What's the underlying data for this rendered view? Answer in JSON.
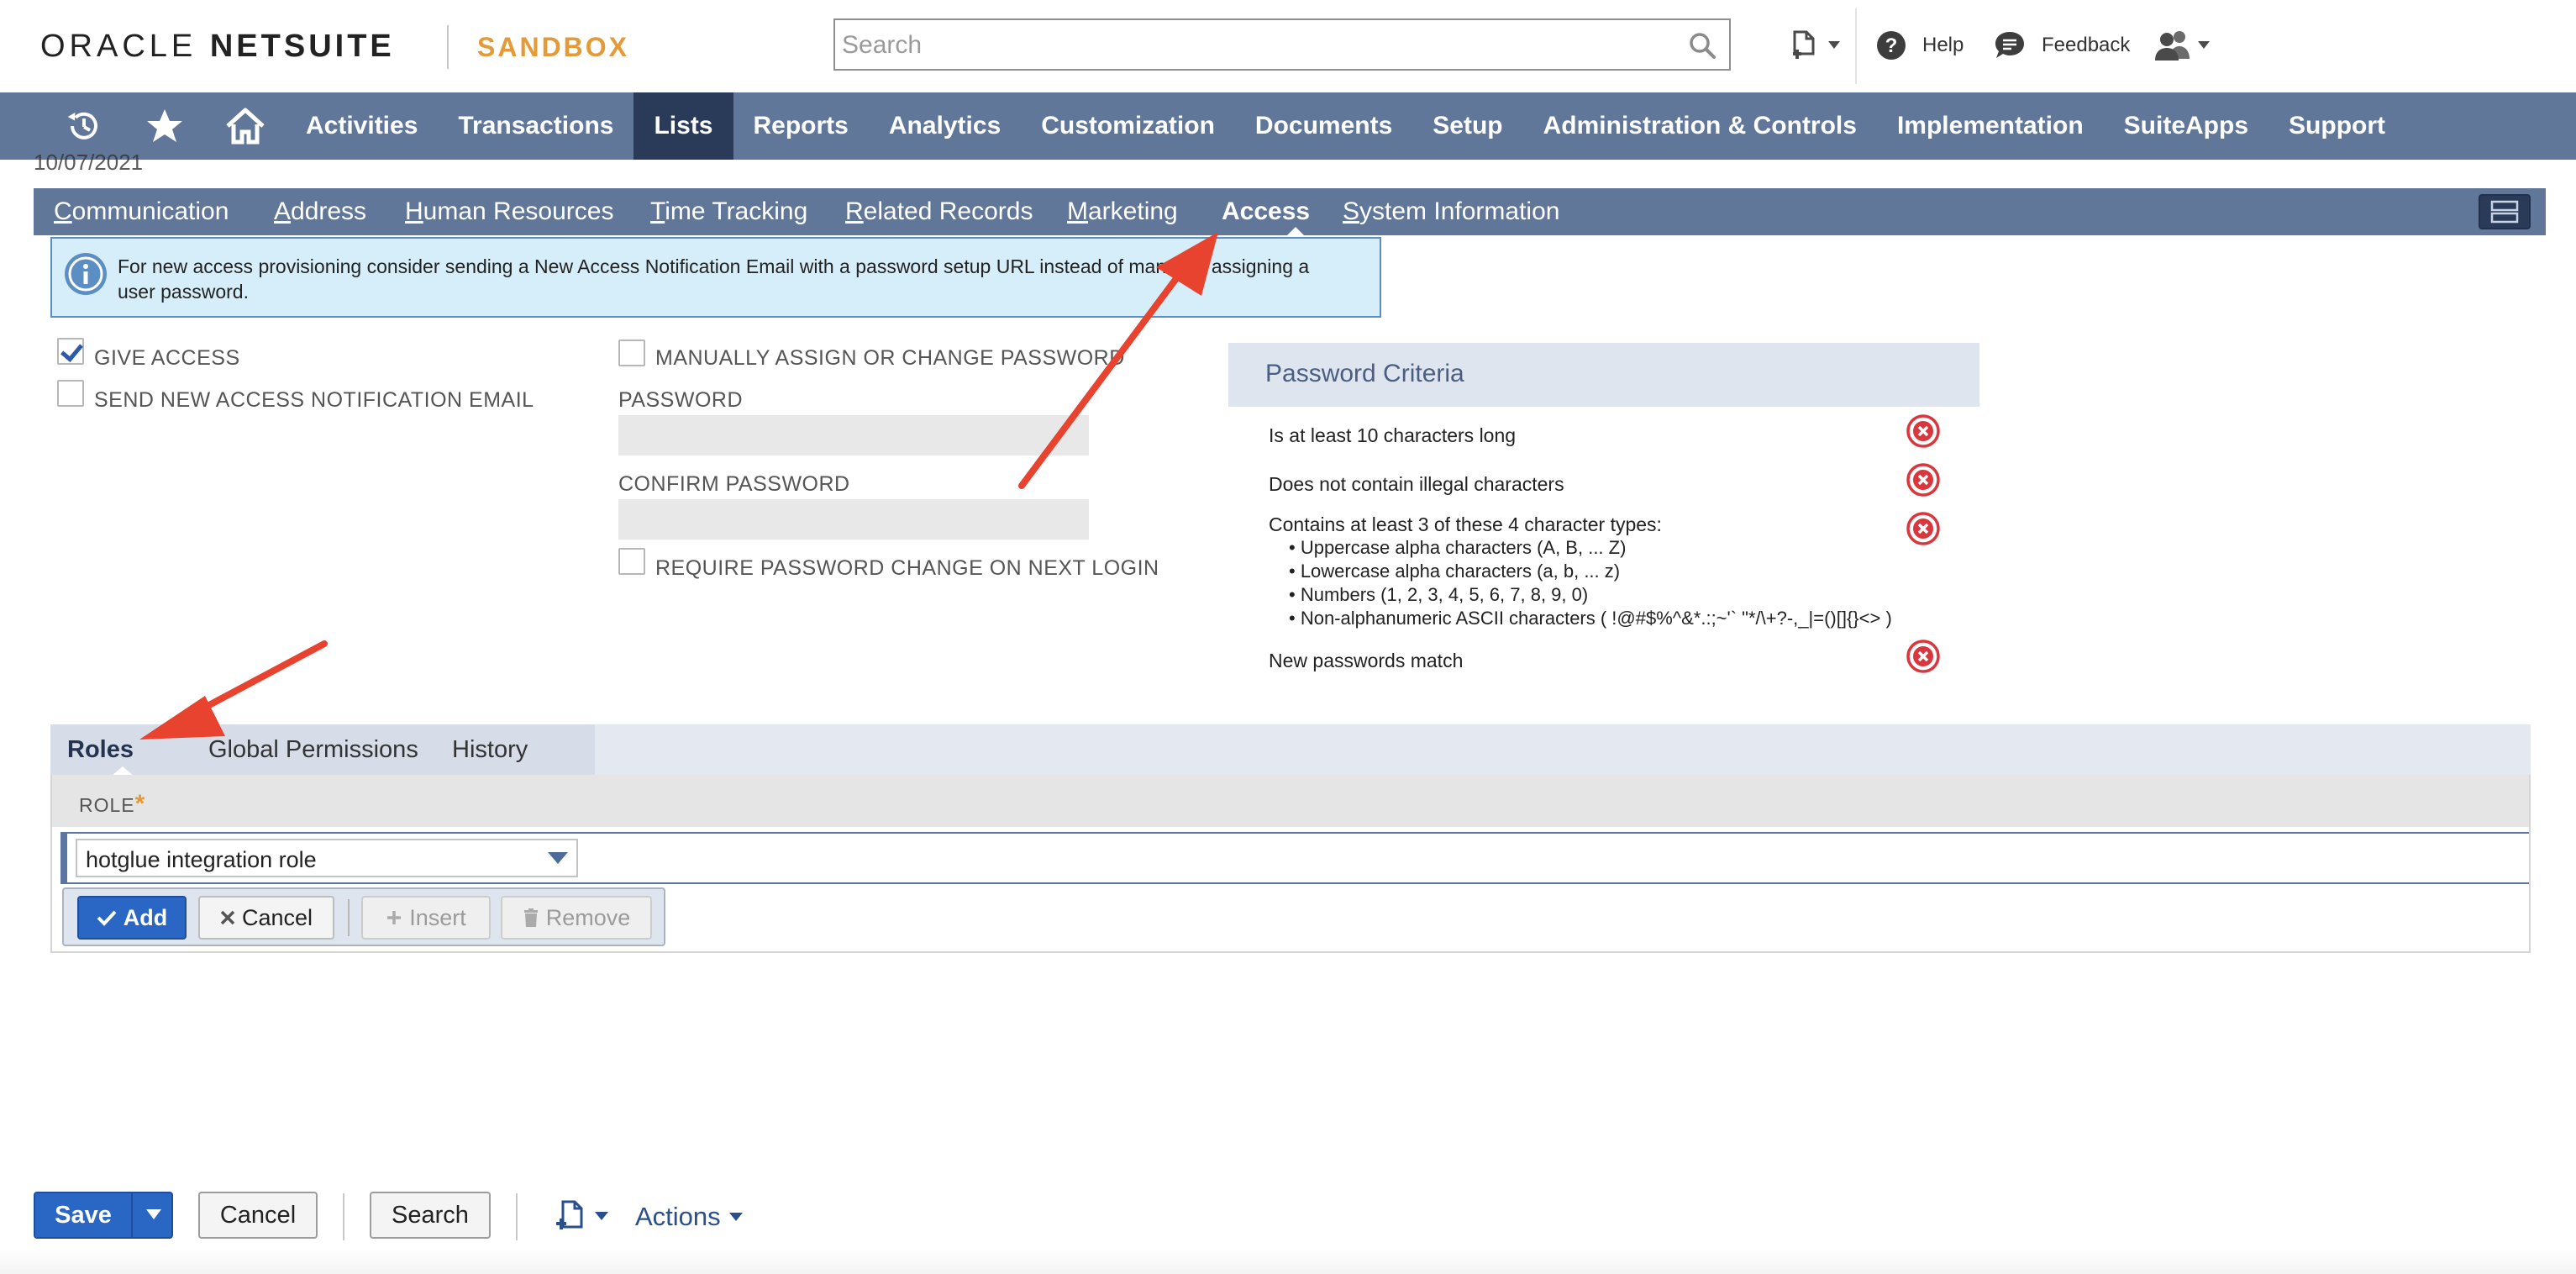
{
  "header": {
    "logo_oracle": "ORACLE",
    "logo_netsuite": "NETSUITE",
    "environment": "SANDBOX",
    "search_placeholder": "Search",
    "help_label": "Help",
    "feedback_label": "Feedback"
  },
  "nav": {
    "items": [
      {
        "label": "Activities"
      },
      {
        "label": "Transactions"
      },
      {
        "label": "Lists"
      },
      {
        "label": "Reports"
      },
      {
        "label": "Analytics"
      },
      {
        "label": "Customization"
      },
      {
        "label": "Documents"
      },
      {
        "label": "Setup"
      },
      {
        "label": "Administration & Controls"
      },
      {
        "label": "Implementation"
      },
      {
        "label": "SuiteApps"
      },
      {
        "label": "Support"
      }
    ],
    "active": "Lists"
  },
  "cutoff_text": "10/07/2021",
  "subtabs": {
    "items": [
      {
        "first": "C",
        "rest": "ommunication"
      },
      {
        "first": "A",
        "rest": "ddress"
      },
      {
        "first": "H",
        "rest": "uman Resources"
      },
      {
        "first": "T",
        "rest": "ime Tracking"
      },
      {
        "first": "R",
        "rest": "elated Records"
      },
      {
        "first": "M",
        "rest": "arketing"
      },
      {
        "first": "",
        "rest": "Access"
      },
      {
        "first": "S",
        "rest": "ystem Information"
      }
    ],
    "active": "Access"
  },
  "info_banner": {
    "text": "For new access provisioning consider sending a New Access Notification Email with a password setup URL instead of manually assigning a user password."
  },
  "access": {
    "give_access_label": "GIVE ACCESS",
    "give_access_checked": true,
    "send_email_label": "SEND NEW ACCESS NOTIFICATION EMAIL",
    "send_email_checked": false,
    "manual_password_label": "MANUALLY ASSIGN OR CHANGE PASSWORD",
    "manual_password_checked": false,
    "password_label": "PASSWORD",
    "password_value": "",
    "confirm_password_label": "CONFIRM PASSWORD",
    "confirm_password_value": "",
    "require_change_label": "REQUIRE PASSWORD CHANGE ON NEXT LOGIN",
    "require_change_checked": false
  },
  "password_criteria": {
    "title": "Password Criteria",
    "rules": [
      "Is at least 10 characters long",
      "Does not contain illegal characters",
      "Contains at least 3 of these 4 character types:",
      "New passwords match"
    ],
    "char_types": [
      "• Uppercase alpha characters (A, B, ... Z)",
      "• Lowercase alpha characters (a, b, ... z)",
      "• Numbers (1, 2, 3, 4, 5, 6, 7, 8, 9, 0)",
      "• Non-alphanumeric ASCII characters ( !@#$%^&*.:;~'` \"*/\\+?-,_|=()[]{}<> )"
    ],
    "status_color": "#d9363e"
  },
  "sublist": {
    "tabs": [
      "Roles",
      "Global Permissions",
      "History"
    ],
    "active_tab": "Roles",
    "role_column": "ROLE",
    "role_value": "hotglue integration role",
    "buttons": {
      "add": "Add",
      "cancel": "Cancel",
      "insert": "Insert",
      "remove": "Remove"
    }
  },
  "footer": {
    "save": "Save",
    "cancel": "Cancel",
    "search": "Search",
    "actions": "Actions"
  },
  "colors": {
    "nav_bg": "#607799",
    "nav_active": "#2a3a59",
    "primary_button": "#2a66c4",
    "sandbox_accent": "#e39a37",
    "annotation_arrow": "#e8432e"
  }
}
